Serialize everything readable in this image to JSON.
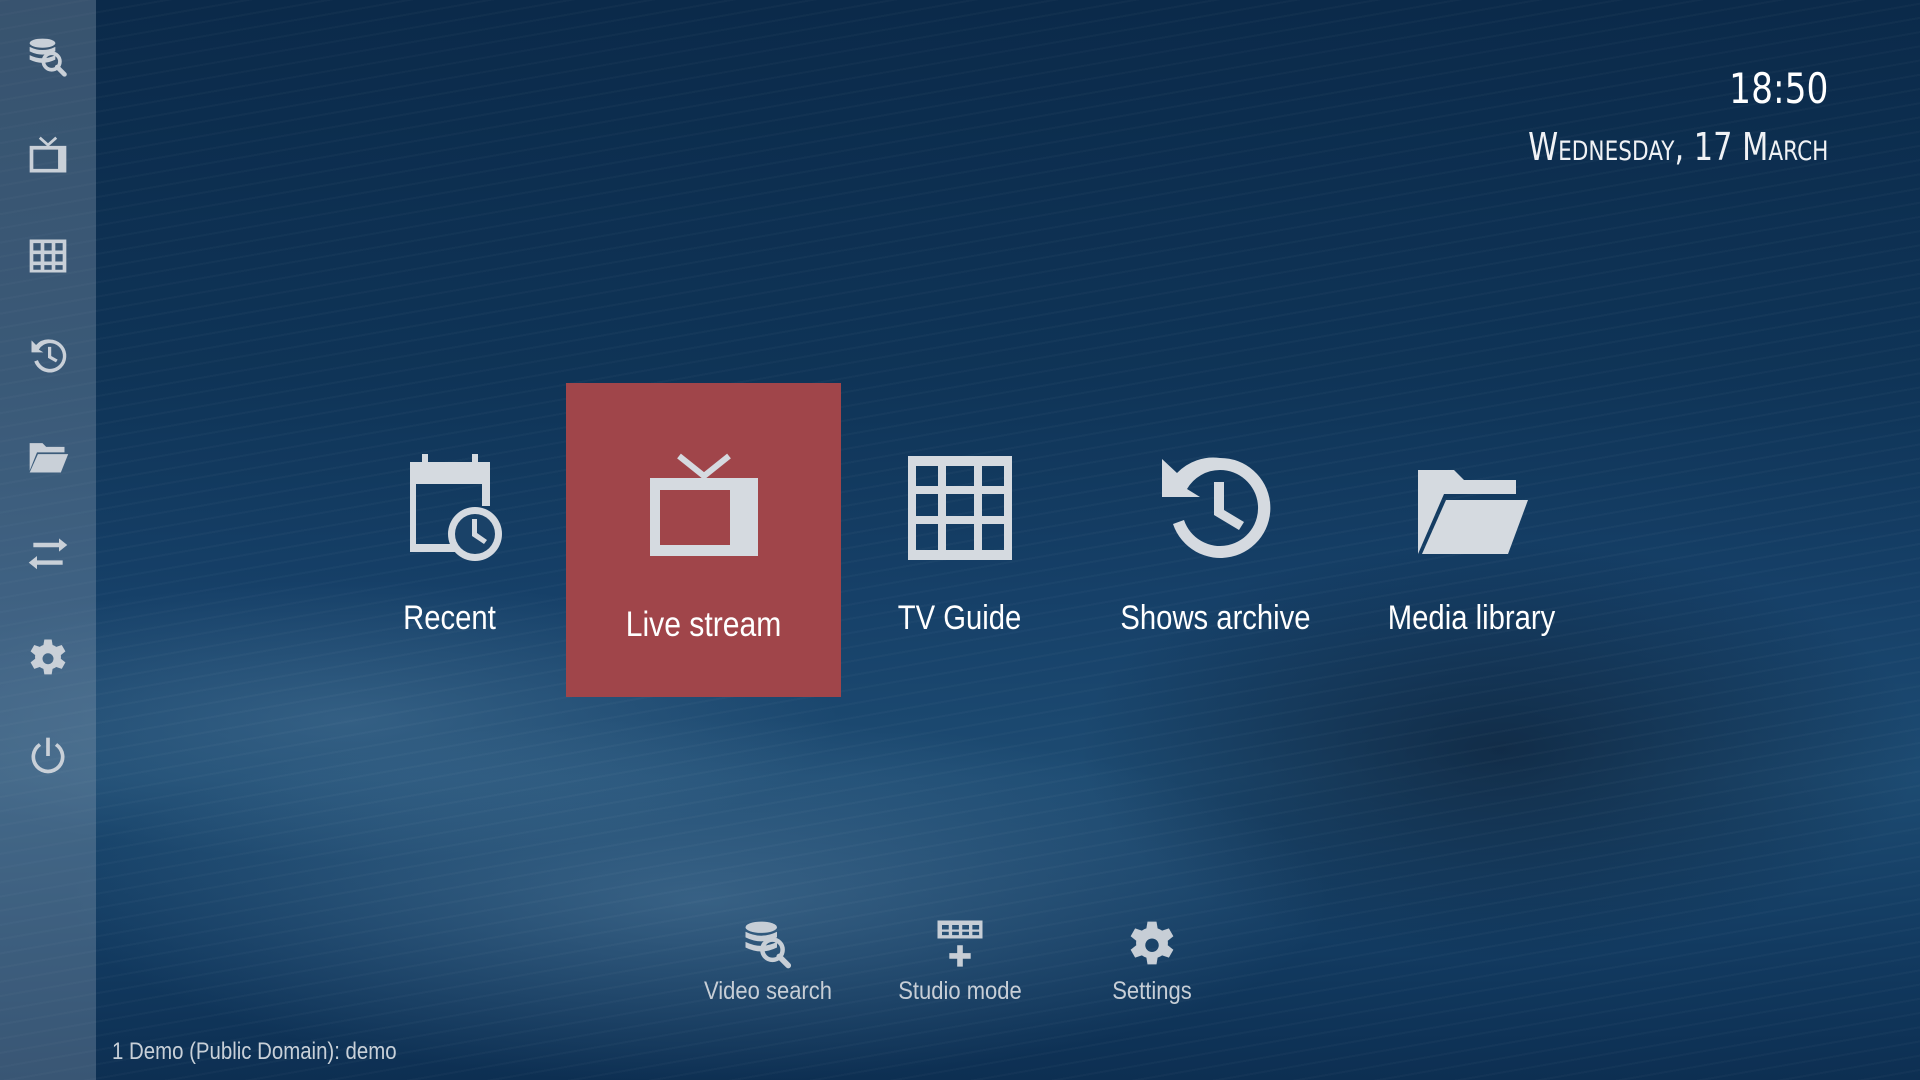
{
  "clock": {
    "time": "18:50",
    "date": "Wednesday, 17 March"
  },
  "sidebar": {
    "items": [
      {
        "icon": "video-search-icon"
      },
      {
        "icon": "tv-icon"
      },
      {
        "icon": "grid-icon"
      },
      {
        "icon": "history-icon"
      },
      {
        "icon": "folder-icon"
      },
      {
        "icon": "swap-arrows-icon"
      },
      {
        "icon": "gear-icon"
      },
      {
        "icon": "power-icon"
      }
    ]
  },
  "main_menu": {
    "items": [
      {
        "label": "Recent",
        "icon": "calendar-clock-icon"
      },
      {
        "label": "Live stream",
        "icon": "tv-icon",
        "selected": true
      },
      {
        "label": "TV Guide",
        "icon": "grid-icon"
      },
      {
        "label": "Shows archive",
        "icon": "history-icon"
      },
      {
        "label": "Media library",
        "icon": "folder-icon"
      }
    ]
  },
  "quick_bar": {
    "items": [
      {
        "label": "Video search",
        "icon": "video-search-icon"
      },
      {
        "label": "Studio mode",
        "icon": "studio-grid-icon"
      },
      {
        "label": "Settings",
        "icon": "gear-icon"
      }
    ]
  },
  "status": {
    "text": "1 Demo (Public Domain): demo"
  },
  "colors": {
    "selected_tile": "#a0454a",
    "background": "#0f3457",
    "sidebar": "#5a7089",
    "icon": "#d5dae0"
  }
}
